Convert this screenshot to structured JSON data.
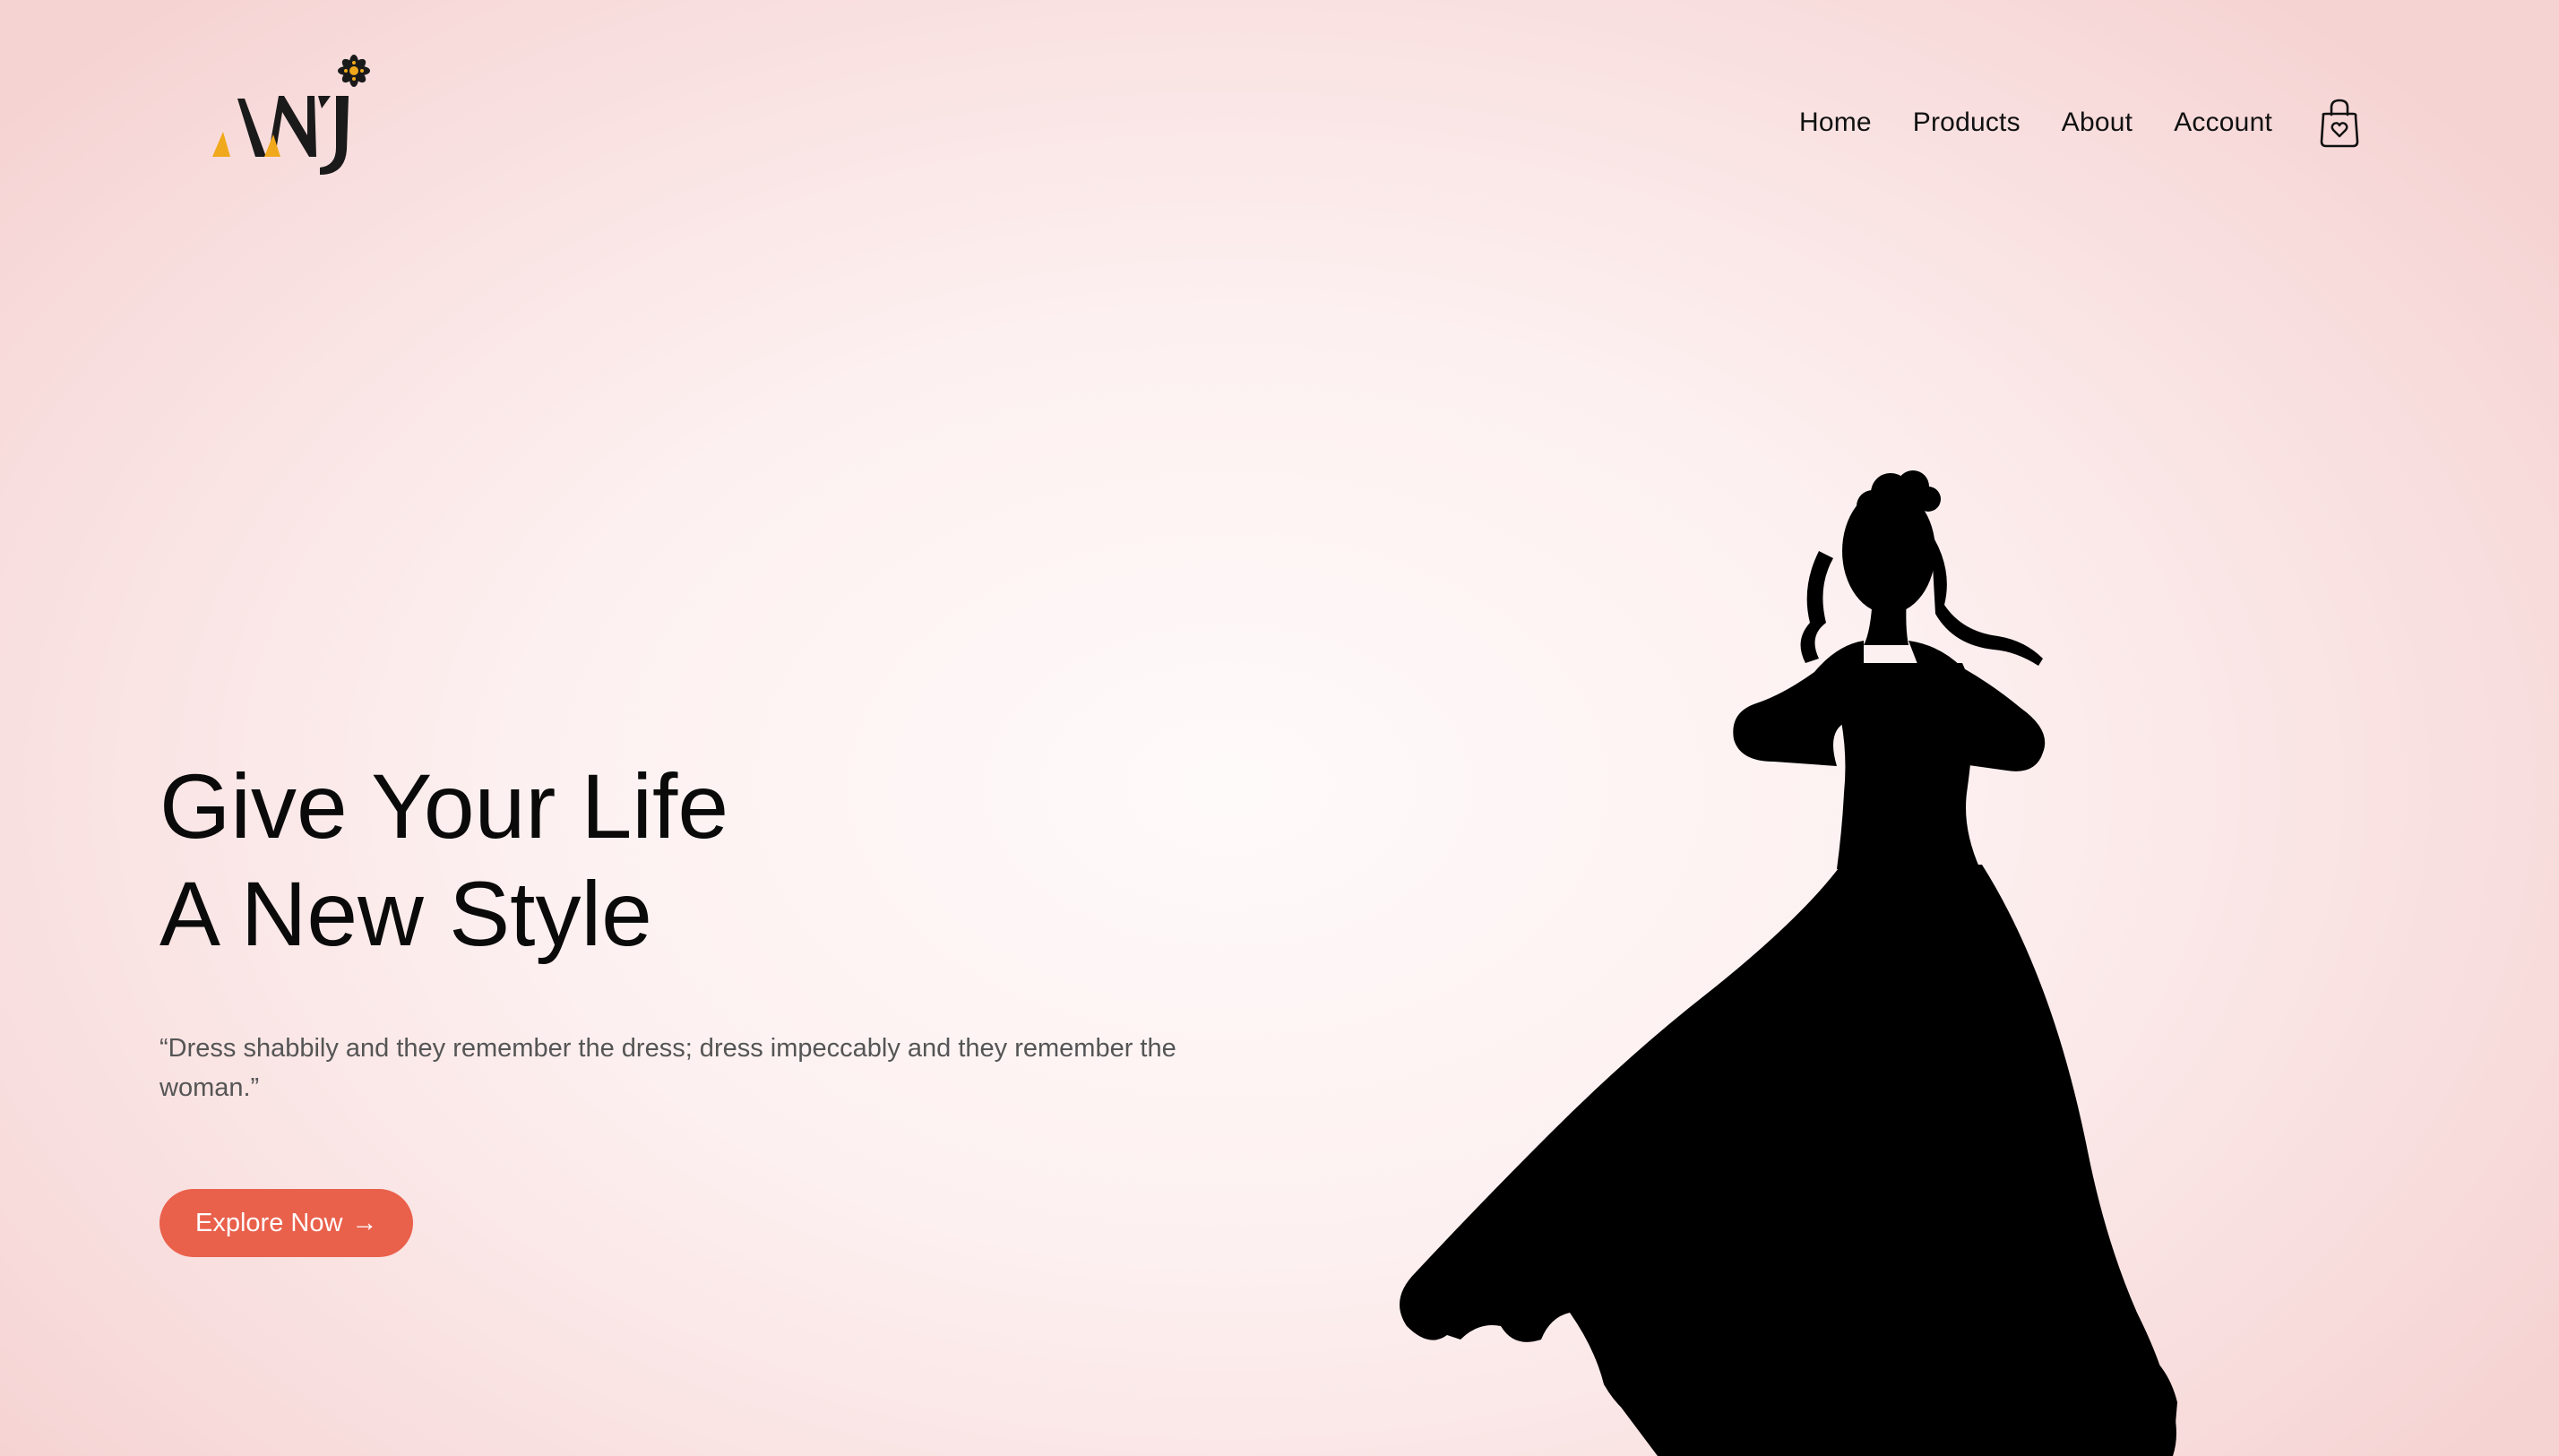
{
  "brand": {
    "logo_text": "ANJ",
    "logo_icon": "flower-icon",
    "accent_color": "#f0a81c",
    "dark_color": "#1a1a1a"
  },
  "nav": {
    "items": [
      {
        "label": "Home"
      },
      {
        "label": "Products"
      },
      {
        "label": "About"
      },
      {
        "label": "Account"
      }
    ],
    "cart_icon": "shopping-bag-heart-icon"
  },
  "hero": {
    "title_line1": "Give Your Life",
    "title_line2": "A New Style",
    "quote": "“Dress shabbily and they remember the dress; dress impeccably and they remember the woman.”",
    "cta_label": "Explore Now",
    "cta_icon": "arrow-right-icon",
    "cta_color": "#e9604b",
    "image": "woman-in-gown-silhouette"
  }
}
